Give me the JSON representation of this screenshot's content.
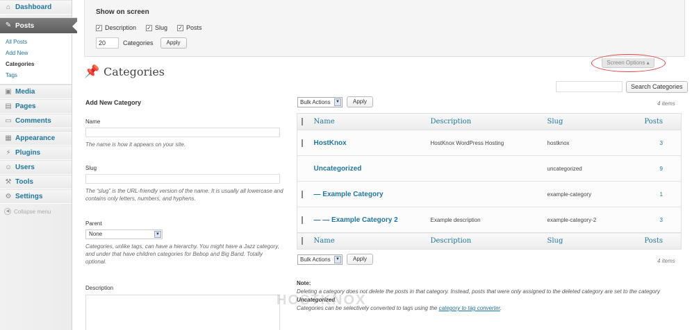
{
  "sidebar": {
    "items": [
      {
        "label": "Dashboard",
        "icon": "dashboard-icon"
      },
      {
        "label": "Posts",
        "icon": "pin-icon"
      },
      {
        "label": "Media",
        "icon": "media-icon"
      },
      {
        "label": "Pages",
        "icon": "pages-icon"
      },
      {
        "label": "Comments",
        "icon": "comments-icon"
      },
      {
        "label": "Appearance",
        "icon": "appearance-icon"
      },
      {
        "label": "Plugins",
        "icon": "plugins-icon"
      },
      {
        "label": "Users",
        "icon": "users-icon"
      },
      {
        "label": "Tools",
        "icon": "tools-icon"
      },
      {
        "label": "Settings",
        "icon": "settings-icon"
      }
    ],
    "posts_submenu": [
      "All Posts",
      "Add New",
      "Categories",
      "Tags"
    ],
    "collapse_label": "Collapse menu"
  },
  "screen_options": {
    "title": "Show on screen",
    "columns": [
      "Description",
      "Slug",
      "Posts"
    ],
    "per_page_value": "20",
    "per_page_label": "Categories",
    "apply_label": "Apply",
    "tab_label": "Screen Options"
  },
  "page": {
    "title": "Categories",
    "search_button": "Search Categories"
  },
  "form": {
    "heading": "Add New Category",
    "name_label": "Name",
    "name_help": "The name is how it appears on your site.",
    "slug_label": "Slug",
    "slug_help": "The “slug” is the URL-friendly version of the name. It is usually all lowercase and contains only letters, numbers, and hyphens.",
    "parent_label": "Parent",
    "parent_value": "None",
    "parent_help": "Categories, unlike tags, can have a hierarchy. You might have a Jazz category, and under that have children categories for Bebop and Big Band. Totally optional.",
    "description_label": "Description"
  },
  "table": {
    "bulk_actions": "Bulk Actions",
    "apply_label": "Apply",
    "items_count": "4 items",
    "headers": {
      "name": "Name",
      "description": "Description",
      "slug": "Slug",
      "posts": "Posts"
    },
    "rows": [
      {
        "name": "HostKnox",
        "description": "HostKnox WordPress Hosting",
        "slug": "hostknox",
        "posts": "3",
        "checkbox": true
      },
      {
        "name": "Uncategorized",
        "description": "",
        "slug": "uncategorized",
        "posts": "9",
        "checkbox": false
      },
      {
        "name": "— Example Category",
        "description": "",
        "slug": "example-category",
        "posts": "1",
        "checkbox": true
      },
      {
        "name": "— — Example Category 2",
        "description": "Example description",
        "slug": "example-category-2",
        "posts": "3",
        "checkbox": true
      }
    ]
  },
  "note": {
    "title": "Note:",
    "line1_a": "Deleting a category does not delete the posts in that category. Instead, posts that were only assigned to the deleted category are set to the category ",
    "line1_b": "Uncategorized",
    "line1_c": ".",
    "line2_a": "Categories can be selectively converted to tags using the ",
    "line2_link": "category to tag converter",
    "line2_c": "."
  },
  "watermark": "HOSTKNOX"
}
